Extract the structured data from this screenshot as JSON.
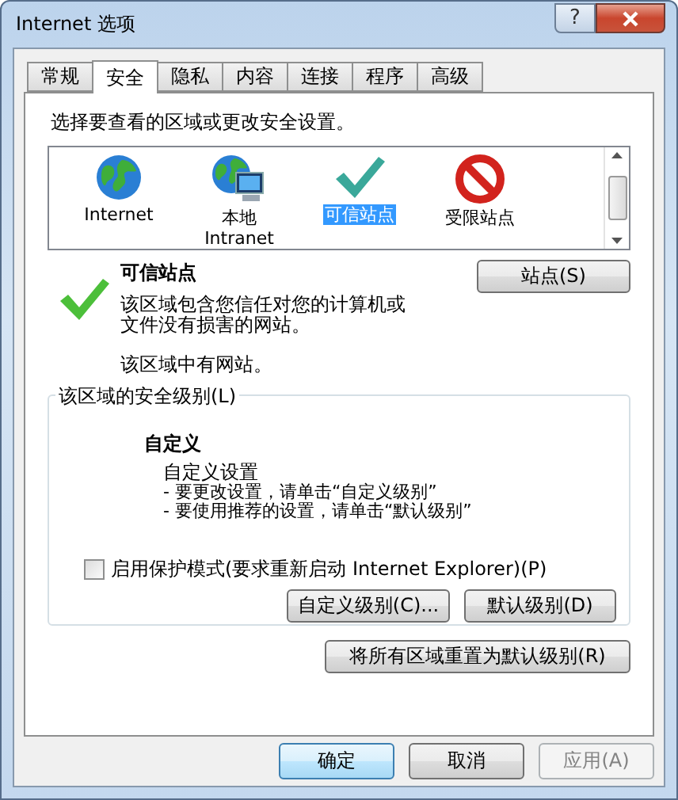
{
  "window": {
    "title": "Internet 选项",
    "help": "?"
  },
  "tabs": [
    {
      "label": "常规",
      "selected": false
    },
    {
      "label": "安全",
      "selected": true
    },
    {
      "label": "隐私",
      "selected": false
    },
    {
      "label": "内容",
      "selected": false
    },
    {
      "label": "连接",
      "selected": false
    },
    {
      "label": "程序",
      "selected": false
    },
    {
      "label": "高级",
      "selected": false
    }
  ],
  "prompt": "选择要查看的区域或更改安全设置。",
  "zones": [
    {
      "label_lines": [
        "Internet"
      ],
      "kind": "globe",
      "selected": false
    },
    {
      "label_lines": [
        "本地",
        "Intranet"
      ],
      "kind": "intranet",
      "selected": false
    },
    {
      "label_lines": [
        "可信站点"
      ],
      "kind": "check",
      "selected": true
    },
    {
      "label_lines": [
        "受限站点"
      ],
      "kind": "blocked",
      "selected": false
    }
  ],
  "zone_detail": {
    "title": "可信站点",
    "description": "该区域包含您信任对您的计算机或文件没有损害的网站。",
    "note": "该区域中有网站。",
    "sites_button": "站点(S)"
  },
  "security_level": {
    "legend": "该区域的安全级别(L)",
    "level_name": "自定义",
    "summary": "自定义设置",
    "lines": [
      "- 要更改设置，请单击“自定义级别”",
      "- 要使用推荐的设置，请单击“默认级别”"
    ],
    "protected_mode": {
      "label": "启用保护模式(要求重新启动 Internet Explorer)(P)",
      "checked": false
    },
    "custom_button": "自定义级别(C)...",
    "default_button": "默认级别(D)"
  },
  "reset_button": "将所有区域重置为默认级别(R)",
  "footer_buttons": [
    {
      "label": "确定",
      "disabled": false,
      "default": true
    },
    {
      "label": "取消",
      "disabled": false,
      "default": false
    },
    {
      "label": "应用(A)",
      "disabled": true,
      "default": false
    }
  ]
}
